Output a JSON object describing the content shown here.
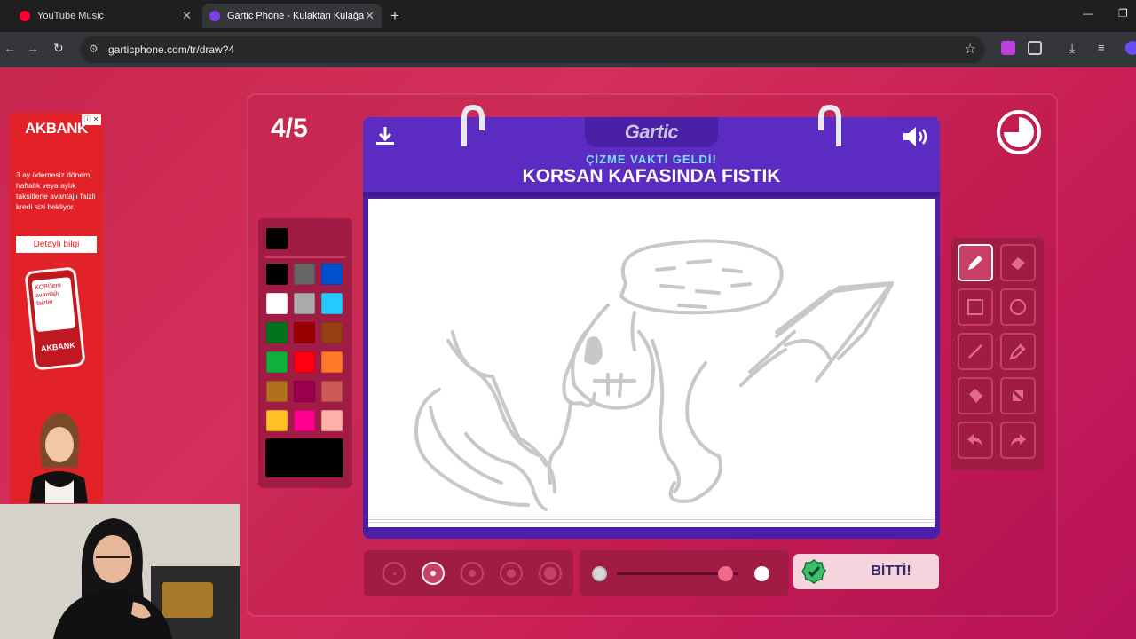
{
  "browser": {
    "tabs": [
      {
        "title": "YouTube Music",
        "icon": "youtube-music-icon",
        "active": false
      },
      {
        "title": "Gartic Phone - Kulaktan Kulağa",
        "icon": "phone-icon",
        "active": true
      }
    ],
    "url": "garticphone.com/tr/draw?4"
  },
  "ad": {
    "brand": "AKBANK",
    "text": "3 ay ödemesiz dönem, haftalık veya aylık taksitlerle avantajlı faizli kredi sizi bekliyor.",
    "button": "Detaylı bilgi",
    "phone_text": "KOBİ'lere avantajlı faizler",
    "phone_brand": "AKBANK"
  },
  "game": {
    "round": "4/5",
    "logo": "Gartic",
    "subtitle": "ÇİZME VAKTİ GELDİ!",
    "word": "KORSAN KAFASINDA FISTIK",
    "done_label": "BİTTİ!",
    "current_color": "#000000",
    "palette": [
      "#000000",
      "#666666",
      "#0050cd",
      "#ffffff",
      "#aaaaaa",
      "#26c9ff",
      "#017420",
      "#990000",
      "#964112",
      "#11b03c",
      "#ff0013",
      "#ff7829",
      "#b0701c",
      "#99004e",
      "#cb5a57",
      "#ffc126",
      "#ff008f",
      "#feafa8"
    ],
    "tools": [
      "pencil-icon",
      "eraser-icon",
      "rectangle-icon",
      "ellipse-icon",
      "line-icon",
      "eyedropper-icon",
      "fill-icon",
      "clear-icon",
      "undo-icon",
      "redo-icon"
    ],
    "selected_tool": "pencil-icon",
    "brush_sizes": 5,
    "selected_brush_size": 2,
    "opacity_level": 0.9
  },
  "colors": {
    "accent_purple": "#5b2bc2",
    "panel": "#a01c45",
    "background": "#c8274f"
  }
}
